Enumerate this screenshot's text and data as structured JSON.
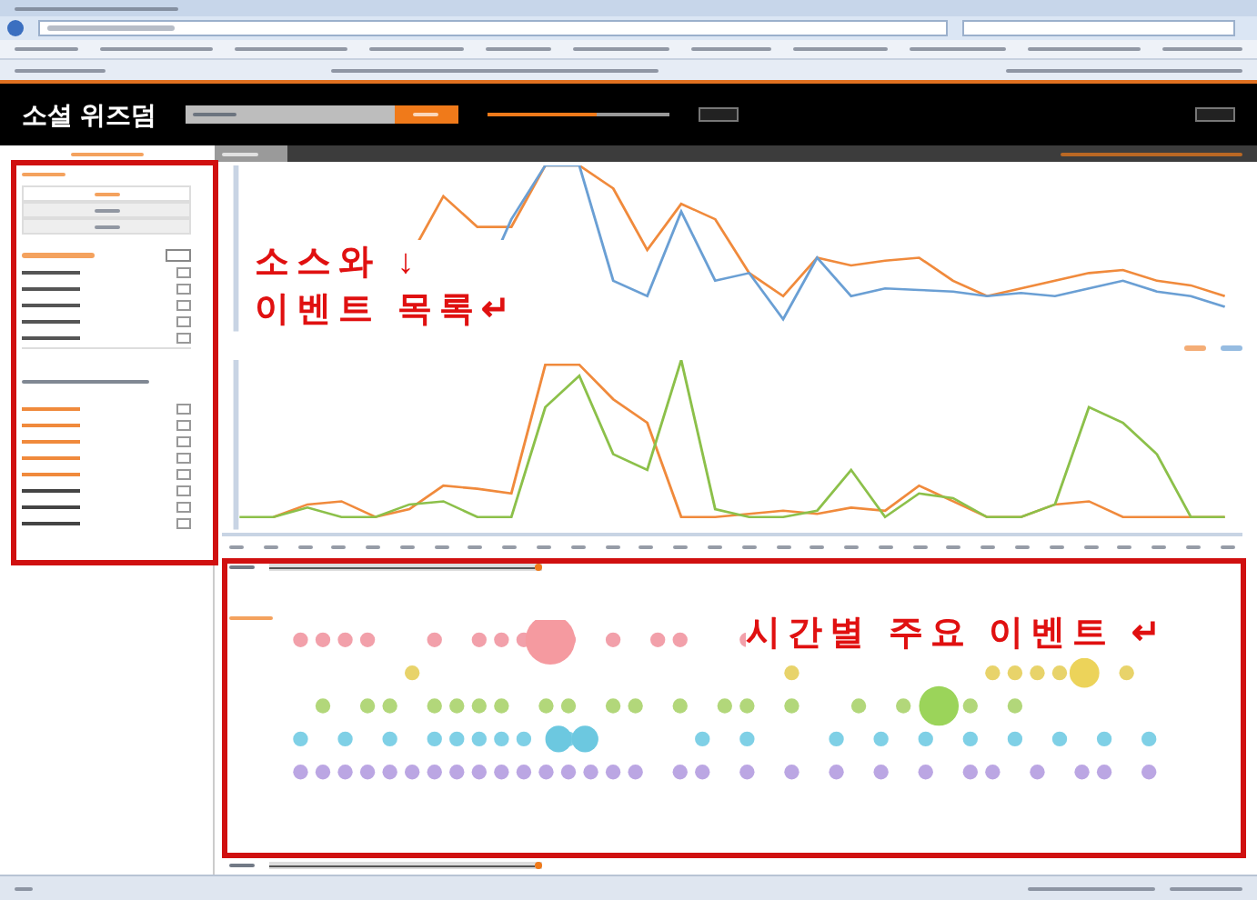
{
  "header": {
    "logo": "소셜 위즈덤",
    "date_range": {
      "level": 0.6
    }
  },
  "timeline": {
    "top_slider": {
      "level": 1
    },
    "bottom_slider": {
      "level": 1
    }
  },
  "source_panel": {
    "sources": [
      {
        "selected": true
      },
      {
        "selected": false
      },
      {
        "selected": false
      }
    ],
    "events": [
      {
        "color": "#555555",
        "checked": false
      },
      {
        "color": "#555555",
        "checked": false
      },
      {
        "color": "#555555",
        "checked": false
      },
      {
        "color": "#555555",
        "checked": false
      },
      {
        "color": "#555555",
        "checked": false
      },
      {
        "color": "#f08a3c",
        "checked": false
      },
      {
        "color": "#f08a3c",
        "checked": false
      },
      {
        "color": "#f08a3c",
        "checked": false
      },
      {
        "color": "#f08a3c",
        "checked": false
      },
      {
        "color": "#f08a3c",
        "checked": false
      },
      {
        "color": "#444444",
        "checked": false
      },
      {
        "color": "#444444",
        "checked": false
      },
      {
        "color": "#444444",
        "checked": false
      }
    ]
  },
  "annotations": [
    {
      "lines": [
        "소스와 ↓",
        "이벤트 목록↵"
      ]
    },
    {
      "lines": [
        "시간별 주요 이벤트 ↵"
      ]
    }
  ]
}
